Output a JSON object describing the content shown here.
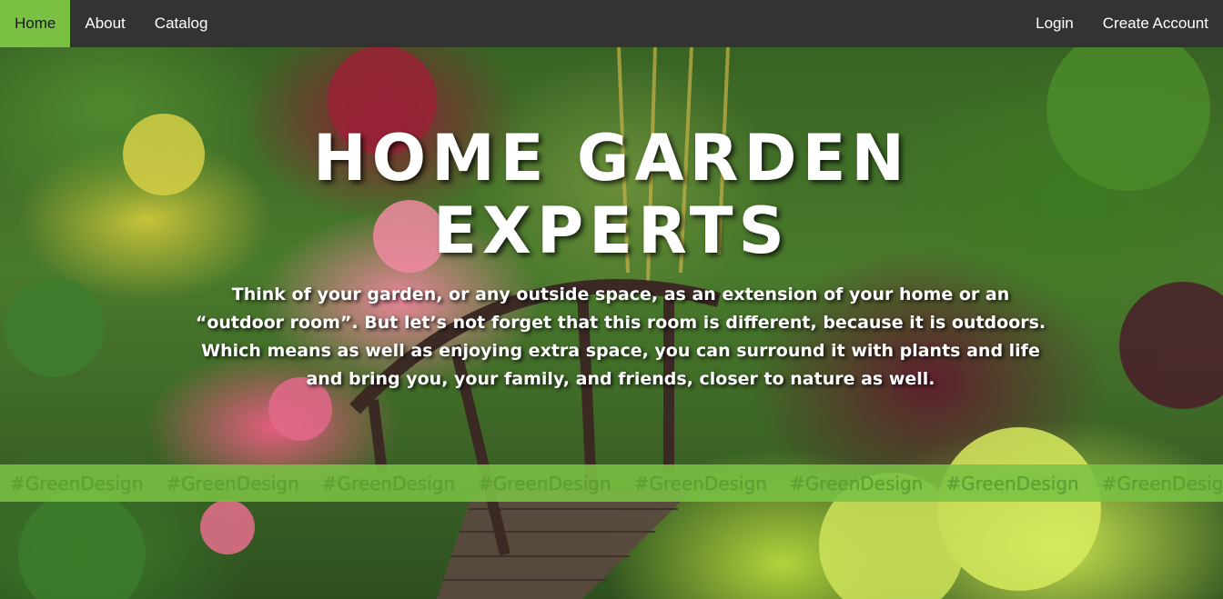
{
  "nav": {
    "left": [
      {
        "label": "Home",
        "active": true
      },
      {
        "label": "About",
        "active": false
      },
      {
        "label": "Catalog",
        "active": false
      }
    ],
    "right": [
      {
        "label": "Login"
      },
      {
        "label": "Create Account"
      }
    ]
  },
  "hero": {
    "title_line1": "HOME GARDEN",
    "title_line2": "EXPERTS",
    "description": "Think of your garden, or any outside space, as an extension of your home or an “outdoor room”. But let’s not forget that this room is different, because it is outdoors. Which means as well as enjoying extra space, you can surround it with plants and life and bring you, your family, and friends, closer to nature as well."
  },
  "tag_banner": {
    "tags": [
      "#GreenDesign",
      "#GreenDesign",
      "#GreenDesign",
      "#GreenDesign",
      "#GreenDesign",
      "#GreenDesign",
      "#GreenDesign",
      "#GreenDesign"
    ]
  },
  "colors": {
    "navbar_bg": "#333333",
    "accent_green": "#7ac143",
    "tag_text": "#5ea132"
  }
}
